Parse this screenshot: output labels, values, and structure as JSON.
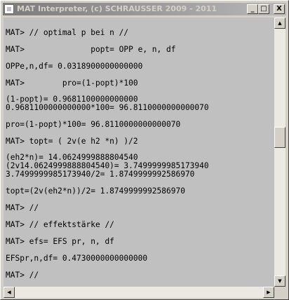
{
  "window": {
    "title": "MAT Interpreter, (c) SCHRAUSSER 2009 - 2011",
    "buttons": {
      "minimize": "_",
      "maximize": "□",
      "close": "X"
    }
  },
  "console": {
    "lines": [
      "MAT> // optimal p bei n //",
      "MAT>              popt= OPP e, n, df",
      "OPPe,n,df= 0.0318900000000000",
      "MAT>        pro=(1-popt)*100",
      "(1-popt)= 0.9681100000000000",
      "0.9681100000000000*100= 96.8110000000000070",
      "pro=(1-popt)*100= 96.8110000000000070",
      "MAT> topt= ( 2v(e h2 *n) )/2",
      "(eh2*n)= 14.0624999888804540",
      "(2v14.0624999888804540)= 3.7499999985173940",
      "3.7499999985173940/2= 1.8749999992586970",
      "topt=(2v(eh2*n))/2= 1.8749999992586970",
      "MAT> //",
      "MAT> // effektstärke //",
      "MAT> efs= EFS pr, n, df",
      "EFSpr,n,df= 0.4730000000000000",
      "MAT> //"
    ]
  },
  "scroll": {
    "up_arrow": "▲",
    "down_arrow": "▼",
    "left_arrow": "◀",
    "right_arrow": "▶"
  },
  "colors": {
    "console_bg": "#c0c0c0",
    "title_gradient_start": "#7b7b7b",
    "title_gradient_end": "#b8b8b8"
  }
}
